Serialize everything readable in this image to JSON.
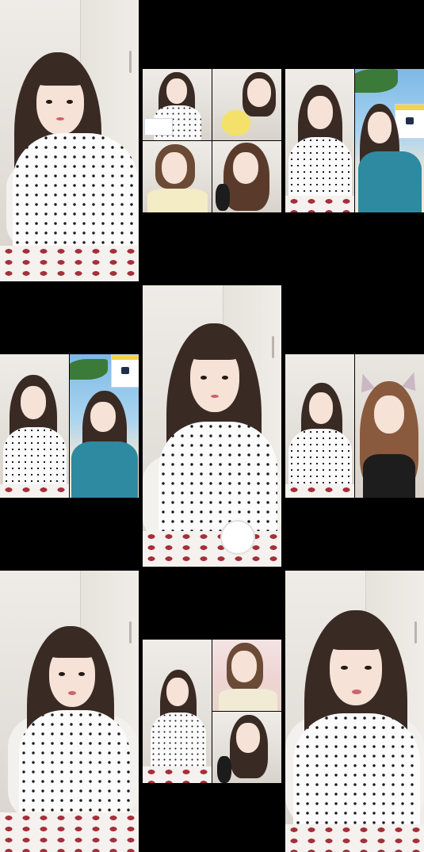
{
  "grid": {
    "rows": 3,
    "cols": 3
  },
  "cells": [
    {
      "name": "cell-1",
      "layout": "single",
      "scenes": [
        "room"
      ]
    },
    {
      "name": "cell-2",
      "layout": "quad",
      "scenes": [
        "room",
        "room",
        "room",
        "room"
      ]
    },
    {
      "name": "cell-3",
      "layout": "split",
      "scenes": [
        "room",
        "beach"
      ]
    },
    {
      "name": "cell-4",
      "layout": "split",
      "scenes": [
        "room",
        "beach"
      ]
    },
    {
      "name": "cell-5",
      "layout": "single",
      "scenes": [
        "room"
      ]
    },
    {
      "name": "cell-6",
      "layout": "split",
      "scenes": [
        "room",
        "dark"
      ]
    },
    {
      "name": "cell-7",
      "layout": "single",
      "scenes": [
        "room"
      ]
    },
    {
      "name": "cell-8",
      "layout": "quad-left",
      "scenes": [
        "room",
        "pinkroom",
        "dark"
      ]
    },
    {
      "name": "cell-9",
      "layout": "single",
      "scenes": [
        "room"
      ]
    }
  ],
  "colors": {
    "background": "#000000",
    "wall": "#efece8",
    "hair": "#3a2a24",
    "skin": "#f6e2d6",
    "dots": "#1b1b1b",
    "pants_print": "#a3303a",
    "sky": "#7db9e6",
    "sign_header": "#f4d24a"
  }
}
